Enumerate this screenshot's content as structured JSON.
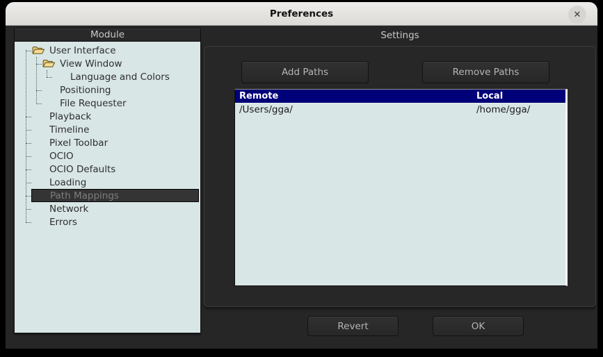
{
  "window": {
    "title": "Preferences",
    "close_glyph": "✕"
  },
  "module_panel": {
    "header": "Module",
    "tree": [
      {
        "label": "User Interface",
        "level": 0,
        "icon": "open-folder",
        "selected": false
      },
      {
        "label": "View Window",
        "level": 1,
        "icon": "open-folder",
        "selected": false
      },
      {
        "label": "Language and Colors",
        "level": 2,
        "icon": null,
        "selected": false
      },
      {
        "label": "Positioning",
        "level": 1,
        "icon": null,
        "selected": false
      },
      {
        "label": "File Requester",
        "level": 1,
        "icon": null,
        "selected": false
      },
      {
        "label": "Playback",
        "level": 0,
        "icon": null,
        "selected": false
      },
      {
        "label": "Timeline",
        "level": 0,
        "icon": null,
        "selected": false
      },
      {
        "label": "Pixel Toolbar",
        "level": 0,
        "icon": null,
        "selected": false
      },
      {
        "label": "OCIO",
        "level": 0,
        "icon": null,
        "selected": false
      },
      {
        "label": "OCIO Defaults",
        "level": 0,
        "icon": null,
        "selected": false
      },
      {
        "label": "Loading",
        "level": 0,
        "icon": null,
        "selected": false
      },
      {
        "label": "Path Mappings",
        "level": 0,
        "icon": null,
        "selected": true
      },
      {
        "label": "Network",
        "level": 0,
        "icon": null,
        "selected": false
      },
      {
        "label": "Errors",
        "level": 0,
        "icon": null,
        "selected": false
      }
    ]
  },
  "settings_panel": {
    "header": "Settings",
    "add_button": "Add Paths",
    "remove_button": "Remove Paths",
    "table": {
      "columns": [
        "Remote",
        "Local"
      ],
      "rows": [
        {
          "remote": "/Users/gga/",
          "local": "/home/gga/"
        }
      ]
    }
  },
  "footer": {
    "revert_button": "Revert",
    "ok_button": "OK"
  },
  "colors": {
    "titlebar_bg": "#e5e3e0",
    "window_bg": "#262626",
    "panel_bg": "#d8e6e5",
    "table_header_bg": "#000078",
    "selected_row_bg": "#343434",
    "folder_icon": "#f0d283",
    "button_text": "#b5b5b5"
  }
}
